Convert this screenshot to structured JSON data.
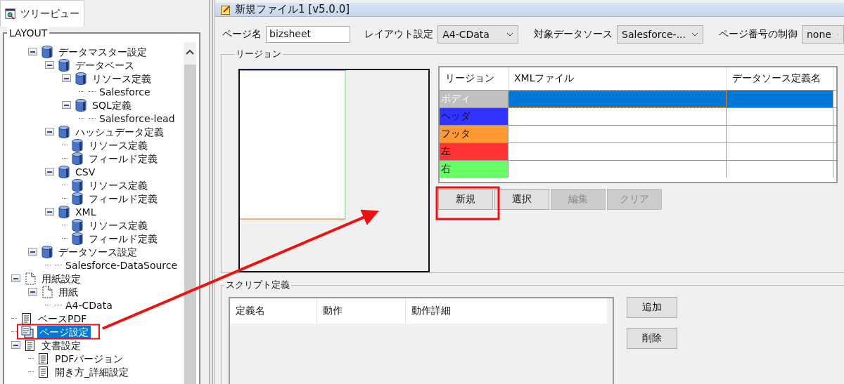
{
  "left_tab": {
    "label": "ツリービュー"
  },
  "tree": {
    "title": "LAYOUT",
    "continued": [
      {
        "label": "データマスター設定",
        "kind": "database",
        "selected": false,
        "expanded": true,
        "children": [
          {
            "label": "データベース",
            "kind": "database",
            "selected": false,
            "expanded": true,
            "children": [
              {
                "label": "リソース定義",
                "kind": "database",
                "selected": false,
                "expanded": true,
                "children": [
                  {
                    "label": "Salesforce",
                    "kind": "leaf",
                    "selected": false
                  }
                ]
              },
              {
                "label": "SQL定義",
                "kind": "database",
                "selected": false,
                "expanded": true,
                "children": [
                  {
                    "label": "Salesforce-lead",
                    "kind": "leaf",
                    "selected": false
                  }
                ]
              }
            ]
          },
          {
            "label": "ハッシュデータ定義",
            "kind": "database",
            "selected": false,
            "expanded": true,
            "children": [
              {
                "label": "リソース定義",
                "kind": "database",
                "selected": false
              },
              {
                "label": "フィールド定義",
                "kind": "database",
                "selected": false
              }
            ]
          },
          {
            "label": "CSV",
            "kind": "database",
            "selected": false,
            "expanded": true,
            "children": [
              {
                "label": "リソース定義",
                "kind": "database",
                "selected": false
              },
              {
                "label": "フィールド定義",
                "kind": "database",
                "selected": false
              }
            ]
          },
          {
            "label": "XML",
            "kind": "database",
            "selected": false,
            "expanded": true,
            "children": [
              {
                "label": "リソース定義",
                "kind": "database",
                "selected": false
              },
              {
                "label": "フィールド定義",
                "kind": "database",
                "selected": false
              }
            ]
          }
        ]
      },
      {
        "label": "データソース設定",
        "kind": "database",
        "selected": false,
        "expanded": true,
        "children": [
          {
            "label": "Salesforce-DataSource",
            "kind": "leaf",
            "selected": false
          }
        ]
      }
    ],
    "items": [
      {
        "label": "用紙設定",
        "kind": "paper",
        "selected": false,
        "expanded": true,
        "children": [
          {
            "label": "用紙",
            "kind": "paper",
            "selected": false,
            "expanded": true,
            "children": [
              {
                "label": "A4-CData",
                "kind": "leaf",
                "selected": false
              }
            ]
          }
        ]
      },
      {
        "label": "ベースPDF",
        "kind": "document",
        "selected": false
      },
      {
        "label": "ページ設定",
        "kind": "pages",
        "selected": true
      },
      {
        "label": "文書設定",
        "kind": "document",
        "selected": false,
        "expanded": true,
        "children": [
          {
            "label": "PDFバージョン",
            "kind": "document",
            "selected": false
          },
          {
            "label": "開き方_詳細設定",
            "kind": "document",
            "selected": false
          }
        ]
      }
    ]
  },
  "window": {
    "title": "新規ファイル1 [v5.0.0]"
  },
  "form": [
    {
      "label": "ページ名",
      "kind": "text",
      "value": "bizsheet"
    },
    {
      "label": "レイアウト設定",
      "kind": "select",
      "value": "A4-CData"
    },
    {
      "label": "対象データソース",
      "kind": "select",
      "value": "Salesforce-..."
    },
    {
      "label": "ページ番号の制御",
      "kind": "select",
      "value": "none"
    }
  ],
  "region": {
    "title": "リージョン",
    "columns": [
      "リージョン",
      "XMLファイル",
      "データソース定義名"
    ],
    "rows": [
      {
        "name": "ボディ",
        "color": "#c0c0c0",
        "selected": true
      },
      {
        "name": "ヘッダ",
        "color": "#3333ff",
        "selected": false
      },
      {
        "name": "フッタ",
        "color": "#ff9933",
        "selected": false
      },
      {
        "name": "左",
        "color": "#ff3333",
        "selected": false
      },
      {
        "name": "右",
        "color": "#66ff66",
        "selected": false
      }
    ],
    "buttons": [
      {
        "label": "新規",
        "disabled": false
      },
      {
        "label": "選択",
        "disabled": false
      },
      {
        "label": "編集",
        "disabled": true
      },
      {
        "label": "クリア",
        "disabled": true
      }
    ]
  },
  "script": {
    "title": "スクリプト定義",
    "columns": [
      "定義名",
      "動作",
      "動作詳細"
    ],
    "buttons": [
      {
        "label": "追加",
        "disabled": false
      },
      {
        "label": "削除",
        "disabled": false
      }
    ]
  }
}
